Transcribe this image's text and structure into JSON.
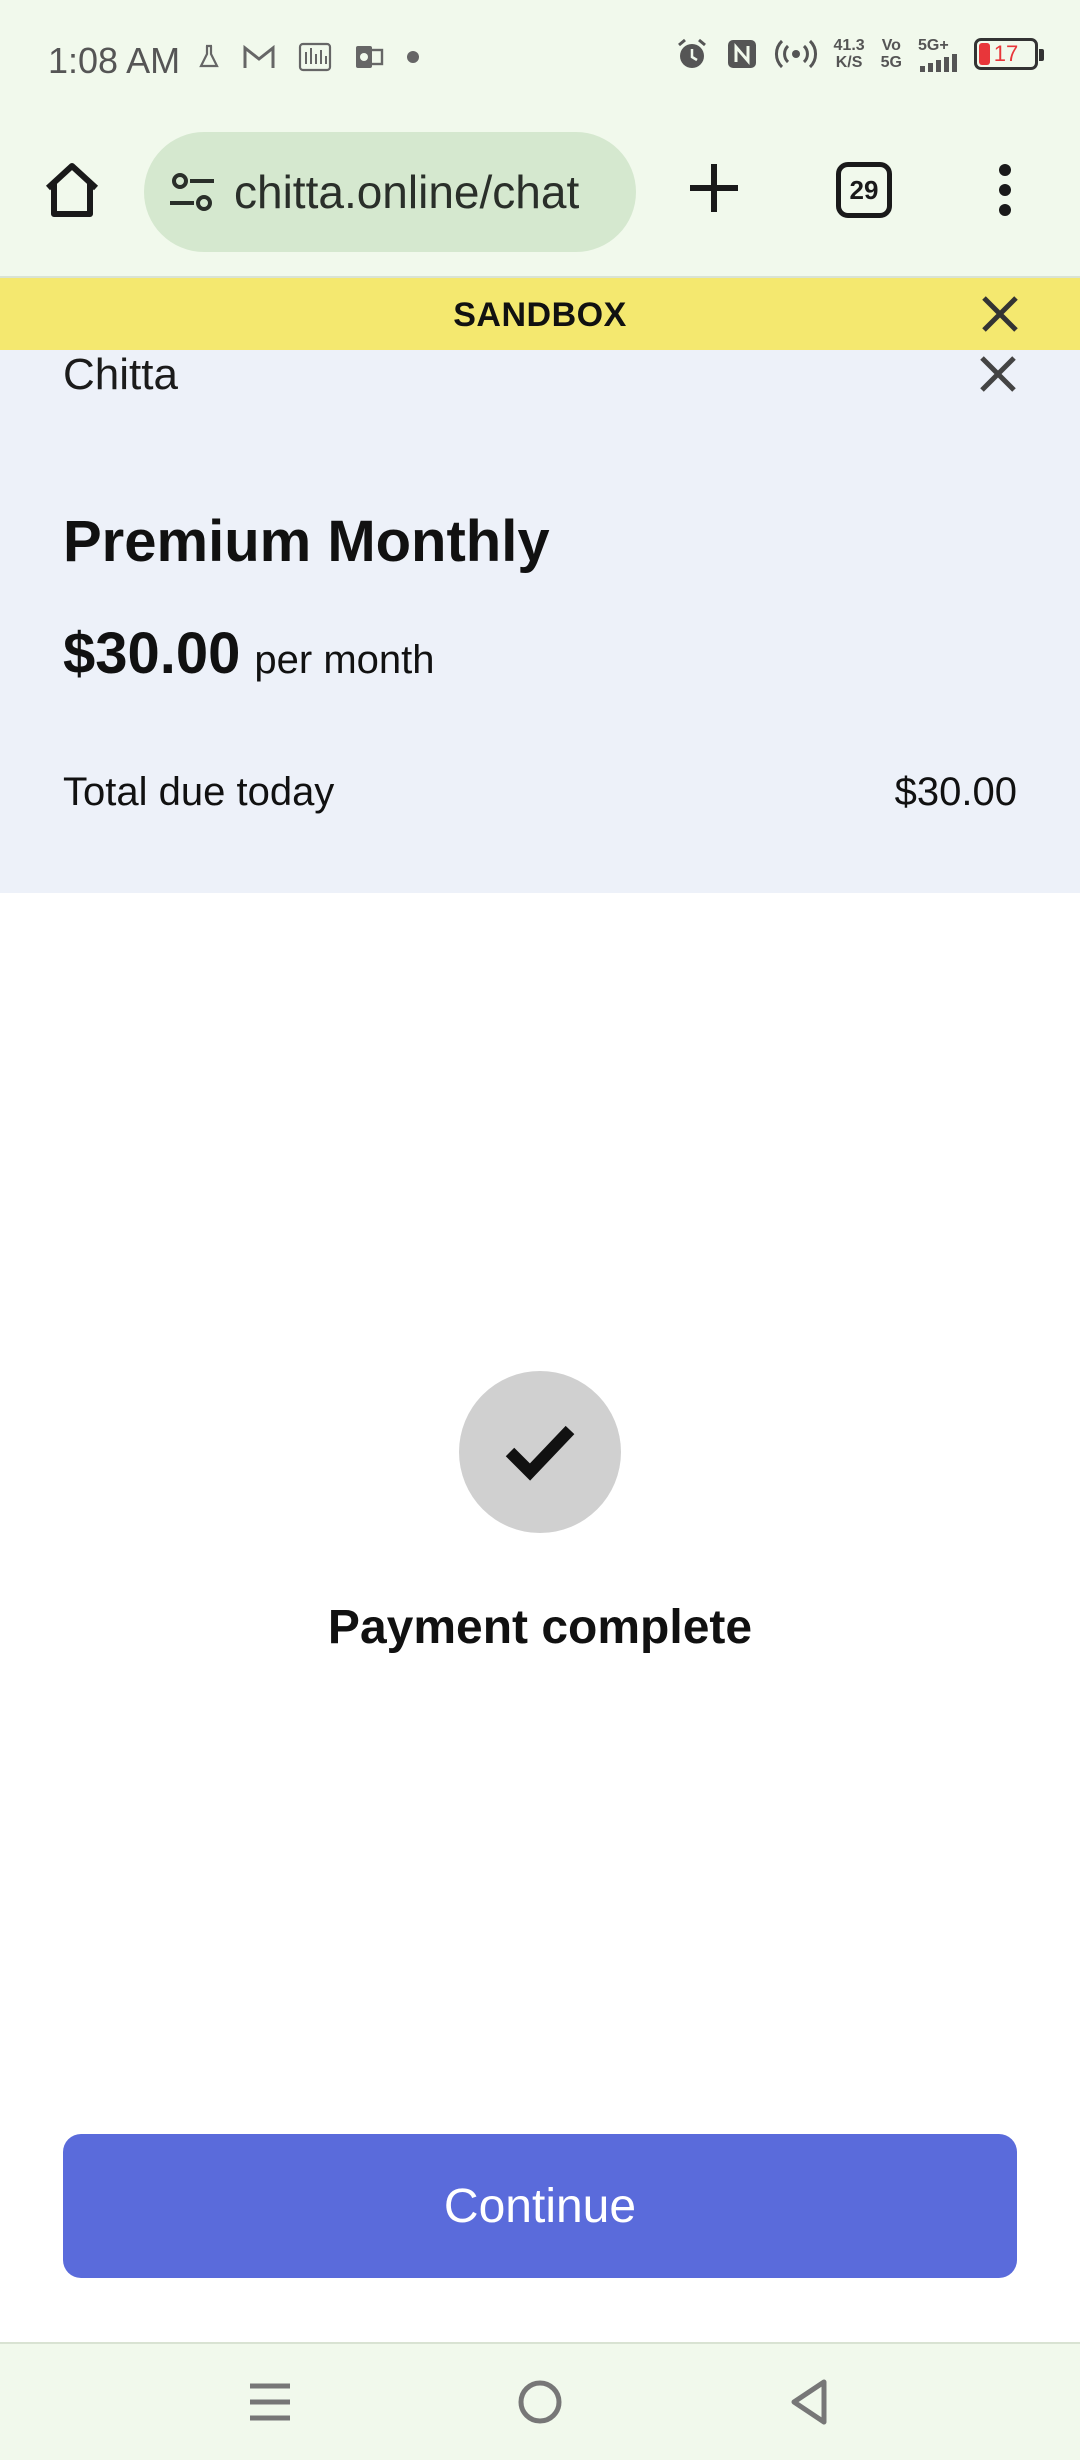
{
  "status_bar": {
    "time": "1:08 AM",
    "left_icons": [
      "flask-icon",
      "gmail-icon",
      "chart-icon",
      "outlook-icon",
      "dot-icon"
    ],
    "right_icons": [
      "alarm-icon",
      "nfc-icon",
      "hotspot-icon",
      "signal-icon"
    ],
    "net_speed_value": "41.3",
    "net_speed_unit": "K/S",
    "volte_top": "Vo",
    "volte_bottom": "5G",
    "network_type": "5G+",
    "battery_level": "17",
    "battery_color": "#e8363a"
  },
  "browser": {
    "url": "chitta.online/chat",
    "tab_count": "29",
    "icons": [
      "home-icon",
      "site-settings-icon",
      "plus-icon",
      "tabs-icon",
      "more-vert-icon"
    ]
  },
  "sandbox_banner": {
    "label": "SANDBOX",
    "color": "#f4e86f"
  },
  "checkout": {
    "merchant": "Chitta",
    "plan_name": "Premium Monthly",
    "price": "$30.00",
    "period": "per month",
    "total_label": "Total due today",
    "total_value": "$30.00",
    "status_message": "Payment complete",
    "continue_label": "Continue",
    "accent_color": "#5a6bdb"
  },
  "nav_bar": {
    "buttons": [
      "recents-icon",
      "home-circle-icon",
      "back-icon"
    ]
  }
}
